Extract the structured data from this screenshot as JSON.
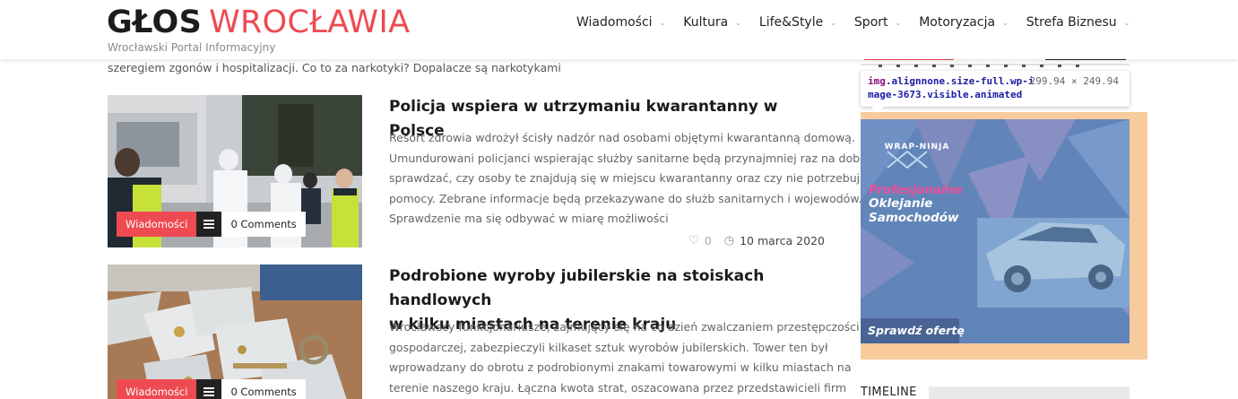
{
  "header": {
    "logo_part1": "GŁOS",
    "logo_part2": "WROCŁAWIA",
    "tagline": "Wrocławski Portal Informacyjny",
    "nav": [
      "Wiadomości",
      "Kultura",
      "Life&Style",
      "Sport",
      "Motoryzacja",
      "Strefa Biznesu"
    ]
  },
  "main": {
    "prev_snippet": "szeregiem zgonów i hospitalizacji. Co to za narkotyki? Dopalacze są narkotykami",
    "posts": [
      {
        "title": "Policja wspiera w utrzymaniu kwarantanny w Polsce",
        "excerpt_lines": [
          "Resort zdrowia wdrożył ścisły nadzór nad osobami objętymi kwarantanną domową.",
          "Umundurowani policjanci wspierając służby sanitarne będą przynajmniej raz na dobę",
          "sprawdzać, czy osoby te znajdują się w miejscu kwarantanny oraz czy nie potrzebują",
          "pomocy. Zebrane informacje będą przekazywane do służb sanitarnych i wojewodów.",
          "Sprawdzenie ma się odbywać w miarę możliwości"
        ],
        "category": "Wiadomości",
        "comments": "0 Comments",
        "likes": "0",
        "date": "10 marca 2020"
      },
      {
        "title_lines": [
          "Podrobione wyroby jubilerskie na stoiskach handlowych",
          "w kilku miastach na terenie kraju"
        ],
        "excerpt_lines": [
          "Wrocławscy funkcjonariusze, zajmujący się na co dzień zwalczaniem przestępczości",
          "gospodarczej, zabezpieczyli kilkaset sztuk wyrobów jubilerskich. Tower ten był",
          "wprowadzany do obrotu z podrobionymi znakami towarowymi w kilku miastach na",
          "terenie naszego kraju. Łączna kwota strat, oszacowana przez przedstawicieli firm"
        ],
        "category": "Wiadomości",
        "comments": "0 Comments"
      }
    ]
  },
  "sidebar": {
    "tooltip": {
      "tag": "img",
      "selector": ".alignnone.size-full.wp-image-3673.visible.animated",
      "dimensions": "299.94 × 249.94"
    },
    "ad": {
      "brand": "WRAP-NINJA",
      "line1": "Profesjonalne",
      "line2": "Oklejanie",
      "line3": "Samochodów",
      "cta": "Sprawdź ofertę"
    },
    "timeline_title": "TIMELINE"
  },
  "colors": {
    "accent": "#ee4a52",
    "ad_backdrop": "#f8cb9d",
    "ad_pink": "#ee4f9a"
  }
}
